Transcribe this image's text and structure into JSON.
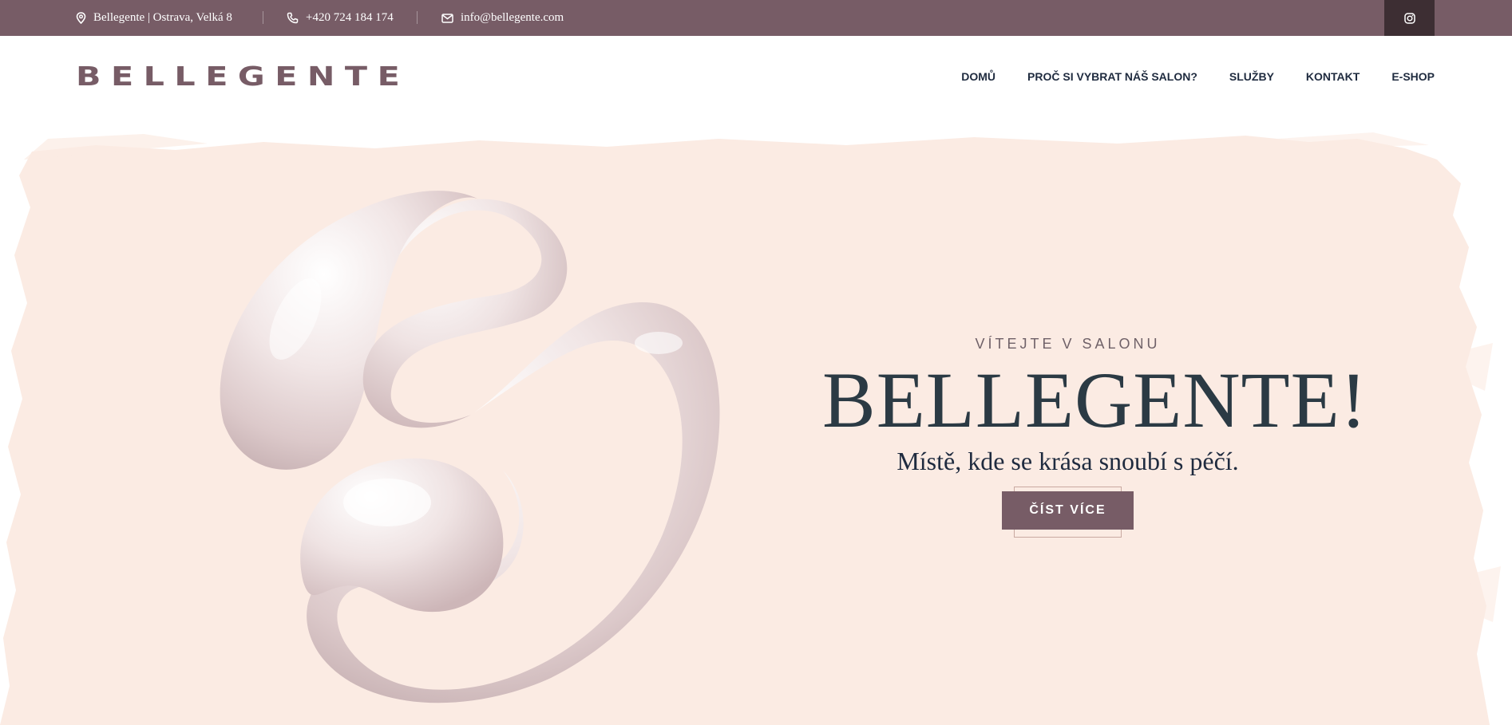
{
  "topbar": {
    "address": "Bellegente | Ostrava, Velká 8",
    "phone": "+420 724 184 174",
    "email": "info@bellegente.com",
    "icons": [
      "location-pin-icon",
      "phone-icon",
      "mail-icon",
      "instagram-icon"
    ]
  },
  "header": {
    "logo": "BELLEGENTE",
    "nav": [
      "DOMŮ",
      "PROČ SI VYBRAT NÁŠ SALON?",
      "SLUŽBY",
      "KONTAKT",
      "E-SHOP"
    ]
  },
  "hero": {
    "eyebrow": "VÍTEJTE V SALONU",
    "title": "BELLEGENTE!",
    "subtitle": "Místě, kde se krása snoubí s péčí.",
    "cta_label": "ČÍST VÍCE"
  },
  "colors": {
    "brand": "#775c66",
    "brand_dark": "#3d2e33",
    "hero_background": "#fbebe3",
    "text_dark": "#1f2b3f"
  }
}
